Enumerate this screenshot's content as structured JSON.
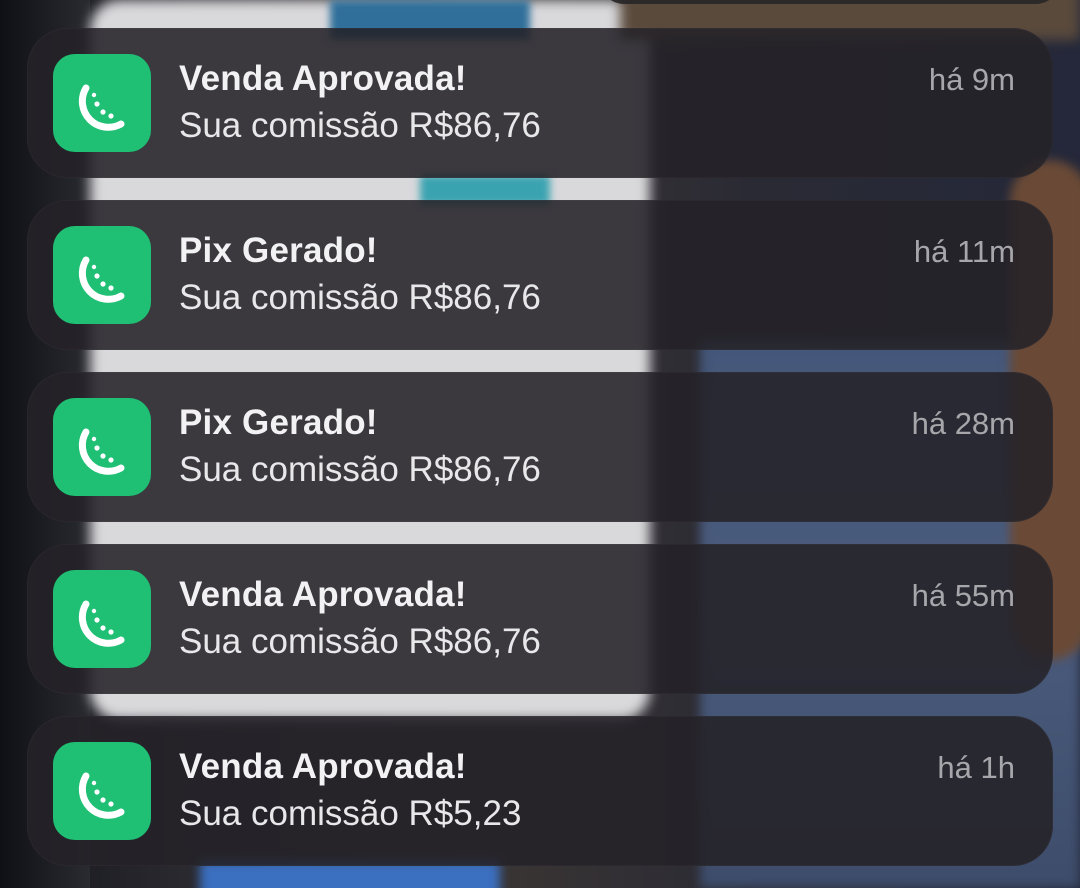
{
  "notifications": [
    {
      "title": "Venda Aprovada!",
      "body": "Sua comissão R$86,76",
      "time": "há 9m",
      "icon": "melon-slice-icon"
    },
    {
      "title": "Pix Gerado!",
      "body": "Sua comissão R$86,76",
      "time": "há 11m",
      "icon": "melon-slice-icon"
    },
    {
      "title": "Pix Gerado!",
      "body": "Sua comissão R$86,76",
      "time": "há 28m",
      "icon": "melon-slice-icon"
    },
    {
      "title": "Venda Aprovada!",
      "body": "Sua comissão R$86,76",
      "time": "há 55m",
      "icon": "melon-slice-icon"
    },
    {
      "title": "Venda Aprovada!",
      "body": "Sua comissão R$5,23",
      "time": "há 1h",
      "icon": "melon-slice-icon"
    }
  ],
  "colors": {
    "app_icon": "#1fbf74",
    "card_background": "#242228",
    "title_text": "#f2f2f4",
    "time_text": "#a7a6ab"
  }
}
